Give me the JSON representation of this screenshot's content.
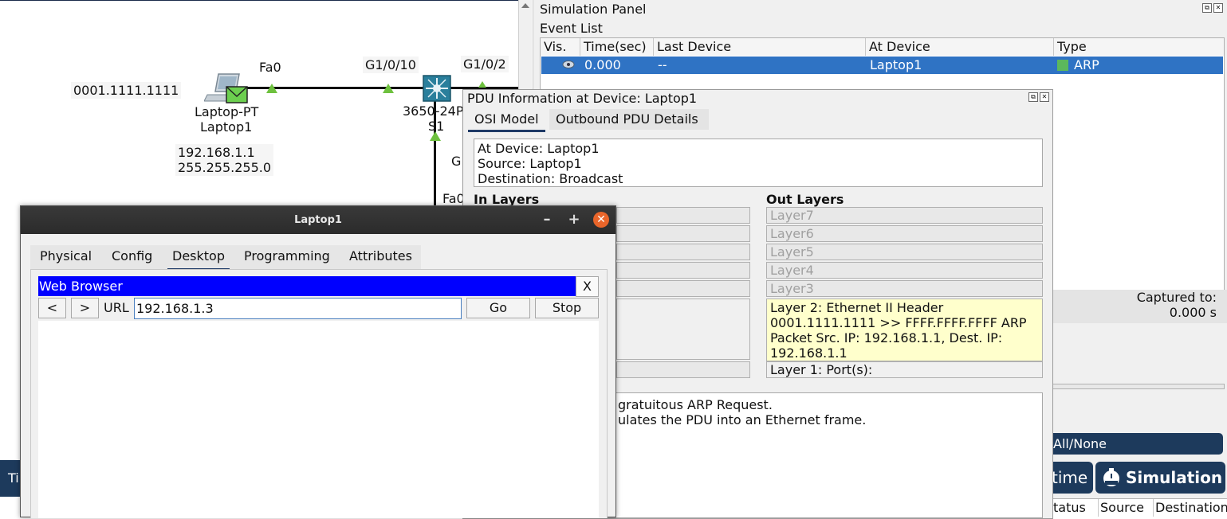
{
  "topology": {
    "laptop_mac": "0001.1111.1111",
    "laptop_model": "Laptop-PT",
    "laptop_name": "Laptop1",
    "laptop_ip": "192.168.1.1",
    "laptop_mask": "255.255.255.0",
    "port_fa0": "Fa0",
    "port_g1010": "G1/0/10",
    "port_g102": "G1/0/2",
    "switch_model": "3650-24P",
    "switch_name": "S1",
    "port_g_partial": "G",
    "port_fa0_lower": "Fa0"
  },
  "simulation_panel": {
    "title": "Simulation Panel",
    "event_list_label": "Event List",
    "columns": [
      "Vis.",
      "Time(sec)",
      "Last Device",
      "At Device",
      "Type"
    ],
    "row": {
      "time": "0.000",
      "last_device": "--",
      "at_device": "Laptop1",
      "type": "ARP"
    },
    "arp_color": "#5cb85c",
    "captured_label": "Captured to:",
    "captured_value": "0.000 s",
    "all_none_partial": "All/None",
    "realtime_partial": "time",
    "simulation_button": "Simulation",
    "bottom_cols": [
      "tatus",
      "Source",
      "Destination"
    ],
    "bottom_left_partial": "Ti"
  },
  "pdu_dialog": {
    "title": "PDU Information at Device: Laptop1",
    "tabs": [
      "OSI Model",
      "Outbound PDU Details"
    ],
    "info": [
      "At Device: Laptop1",
      "Source: Laptop1",
      "Destination: Broadcast"
    ],
    "in_layers_label": "In Layers",
    "out_layers_label": "Out Layers",
    "out_layers": [
      "Layer7",
      "Layer6",
      "Layer5",
      "Layer4",
      "Layer3"
    ],
    "layer2_text": "Layer 2: Ethernet II Header 0001.1111.1111 >> FFFF.FFFF.FFFF ARP Packet Src. IP: 192.168.1.1, Dest. IP: 192.168.1.1",
    "layer1_text": "Layer 1: Port(s):",
    "description_line1": "gratuitous ARP Request.",
    "description_line2": "ulates the PDU into an Ethernet frame."
  },
  "laptop_window": {
    "title": "Laptop1",
    "tabs": [
      "Physical",
      "Config",
      "Desktop",
      "Programming",
      "Attributes"
    ],
    "browser_title": "Web Browser",
    "close_x": "X",
    "back": "<",
    "forward": ">",
    "url_label": "URL",
    "url_value": "192.168.1.3",
    "go": "Go",
    "stop": "Stop",
    "accent": "#0000ff"
  }
}
